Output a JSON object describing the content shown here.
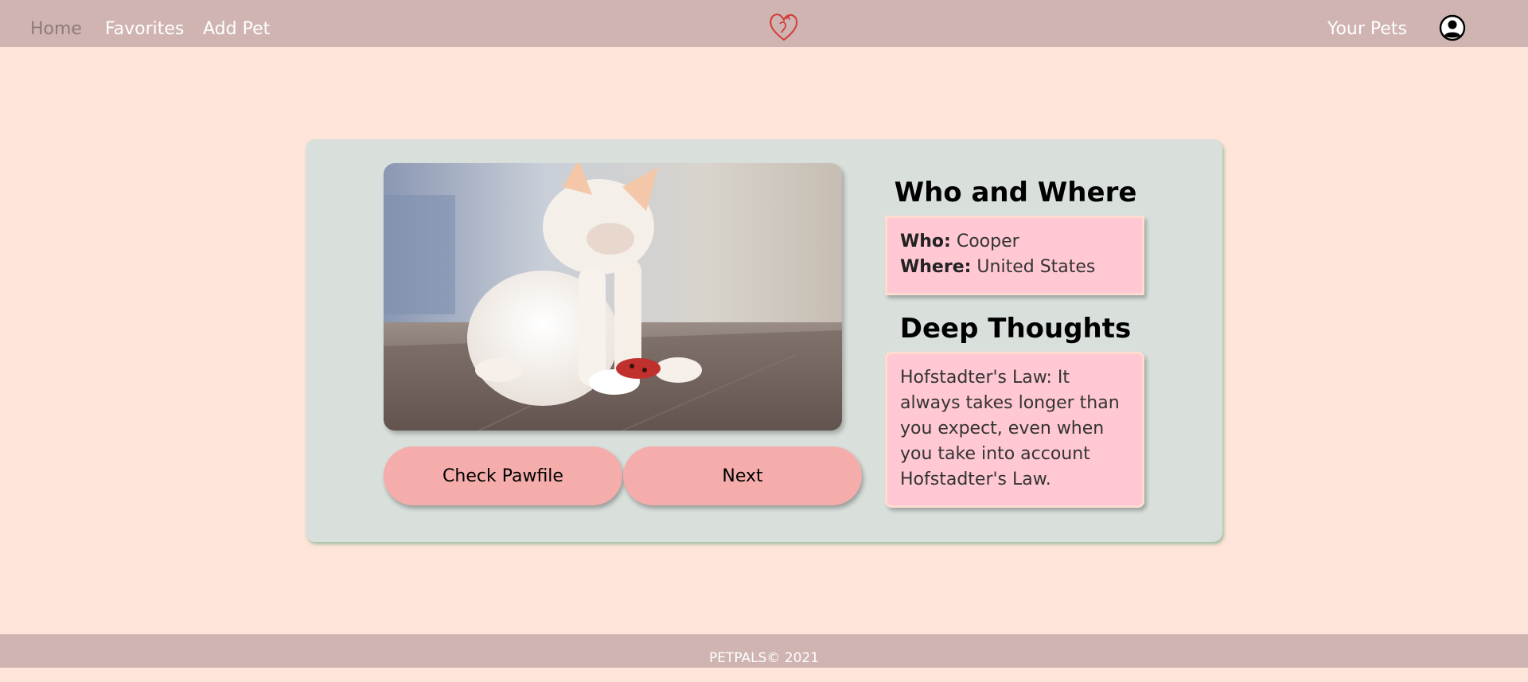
{
  "nav": {
    "home": "Home",
    "favorites": "Favorites",
    "add_pet": "Add Pet",
    "your_pets": "Your Pets"
  },
  "colors": {
    "accent_logo": "#d23b3b",
    "nav_bg": "#cfb4b2",
    "page_bg": "#ffe4da",
    "card_bg": "#d9e0dc",
    "button_bg": "#f4adab",
    "box_bg": "#ffc8d3"
  },
  "icons": {
    "logo": "heart-pet-logo-icon",
    "account": "account-circle-icon"
  },
  "pet": {
    "photo_alt": "white-kitten-photo",
    "who_where": {
      "title": "Who and Where",
      "who_label": "Who:",
      "who_value": "Cooper",
      "where_label": "Where:",
      "where_value": "United States"
    },
    "deep_thoughts": {
      "title": "Deep Thoughts",
      "text": "Hofstadter's Law: It always takes longer than you expect, even when you take into account Hofstadter's Law."
    }
  },
  "buttons": {
    "check_pawfile": "Check Pawfile",
    "next": "Next"
  },
  "footer": {
    "text": "PETPALS© 2021"
  }
}
